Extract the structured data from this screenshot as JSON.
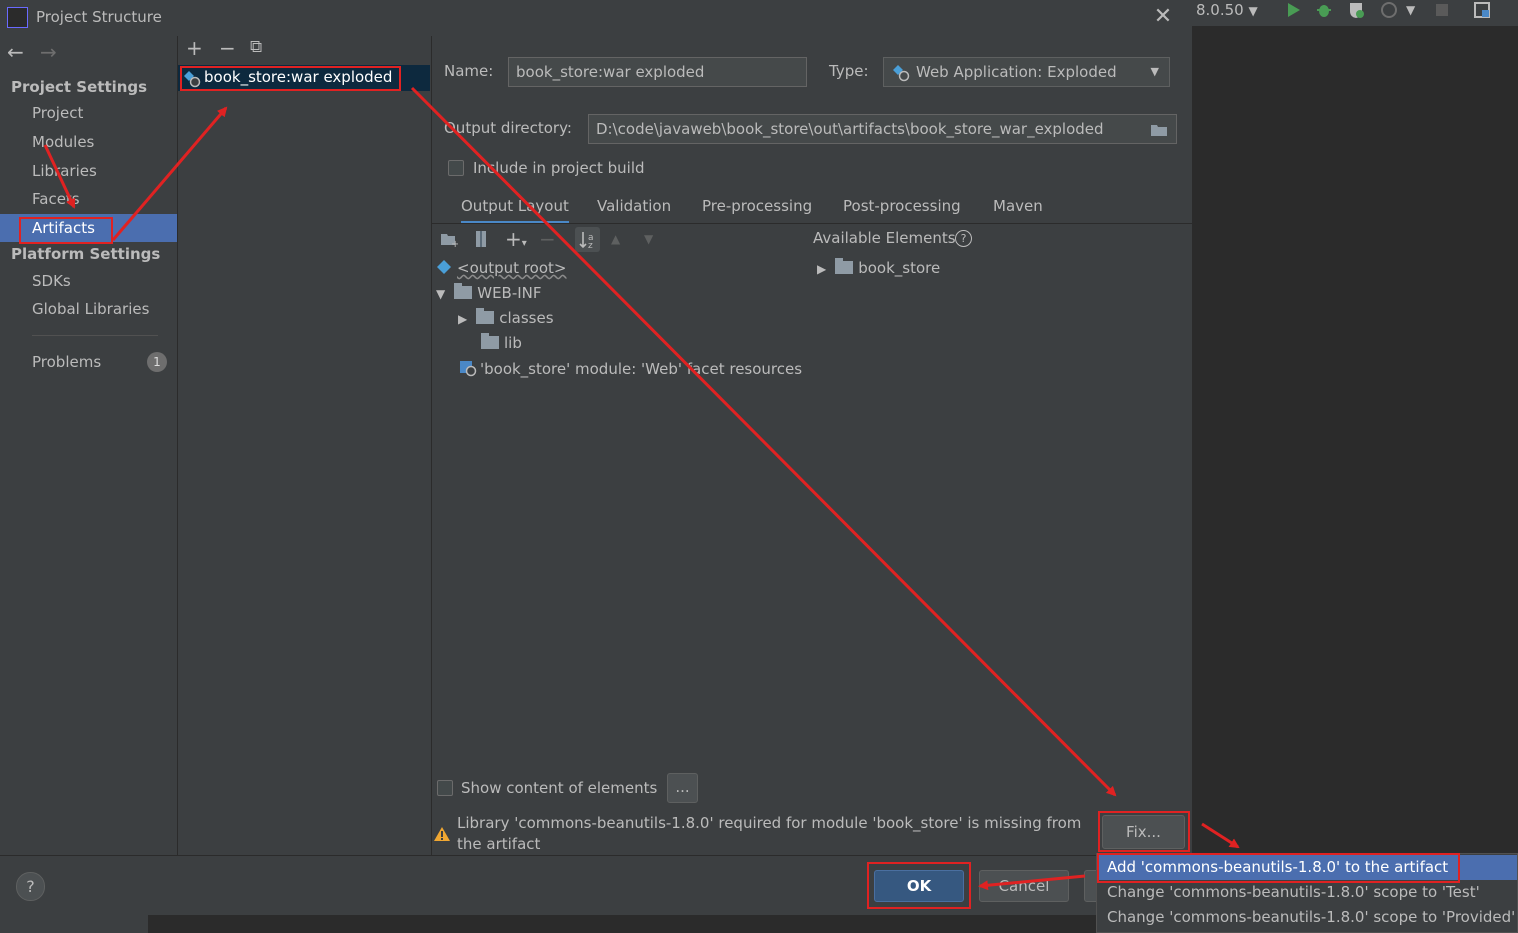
{
  "ide": {
    "config_label": "8.0.50"
  },
  "dialog": {
    "title": "Project Structure",
    "close_glyph": "✕"
  },
  "nav": {
    "back_glyph": "←",
    "forward_glyph": "→",
    "project_settings_heading": "Project Settings",
    "project_settings_items": [
      "Project",
      "Modules",
      "Libraries",
      "Facets",
      "Artifacts"
    ],
    "platform_settings_heading": "Platform Settings",
    "platform_settings_items": [
      "SDKs",
      "Global Libraries"
    ],
    "problems_label": "Problems",
    "problems_count": "1",
    "selected_item": "Artifacts"
  },
  "artifacts_list": {
    "add_glyph": "+",
    "remove_glyph": "−",
    "copy_glyph": "⧉",
    "items": [
      "book_store:war exploded"
    ]
  },
  "artifact": {
    "name_label": "Name:",
    "name_value": "book_store:war exploded",
    "type_label": "Type:",
    "type_value": "Web Application: Exploded",
    "output_dir_label": "Output directory:",
    "output_dir_value": "D:\\code\\javaweb\\book_store\\out\\artifacts\\book_store_war_exploded",
    "include_build_label": "Include in project build"
  },
  "tabs": [
    "Output Layout",
    "Validation",
    "Pre-processing",
    "Post-processing",
    "Maven"
  ],
  "layout_tree": {
    "output_root": "<output root>",
    "web_inf": "WEB-INF",
    "classes": "classes",
    "lib": "lib",
    "facet_resources": "'book_store' module: 'Web' facet resources"
  },
  "available": {
    "heading": "Available Elements",
    "items": [
      "book_store"
    ]
  },
  "bottom": {
    "show_content_label": "Show content of elements",
    "ellipsis_label": "...",
    "warning_text_line1": "Library 'commons-beanutils-1.8.0' required for module 'book_store' is missing from",
    "warning_text_line2": "the artifact",
    "fix_label": "Fix...",
    "help_label": "?",
    "ok_label": "OK",
    "cancel_label": "Cancel"
  },
  "popup": {
    "items": [
      "Add 'commons-beanutils-1.8.0' to the artifact",
      "Change 'commons-beanutils-1.8.0' scope to 'Test'",
      "Change 'commons-beanutils-1.8.0' scope to 'Provided'"
    ]
  },
  "colors": {
    "selection": "#4b6eaf",
    "annotation": "#e02222",
    "ok_button": "#365880"
  }
}
